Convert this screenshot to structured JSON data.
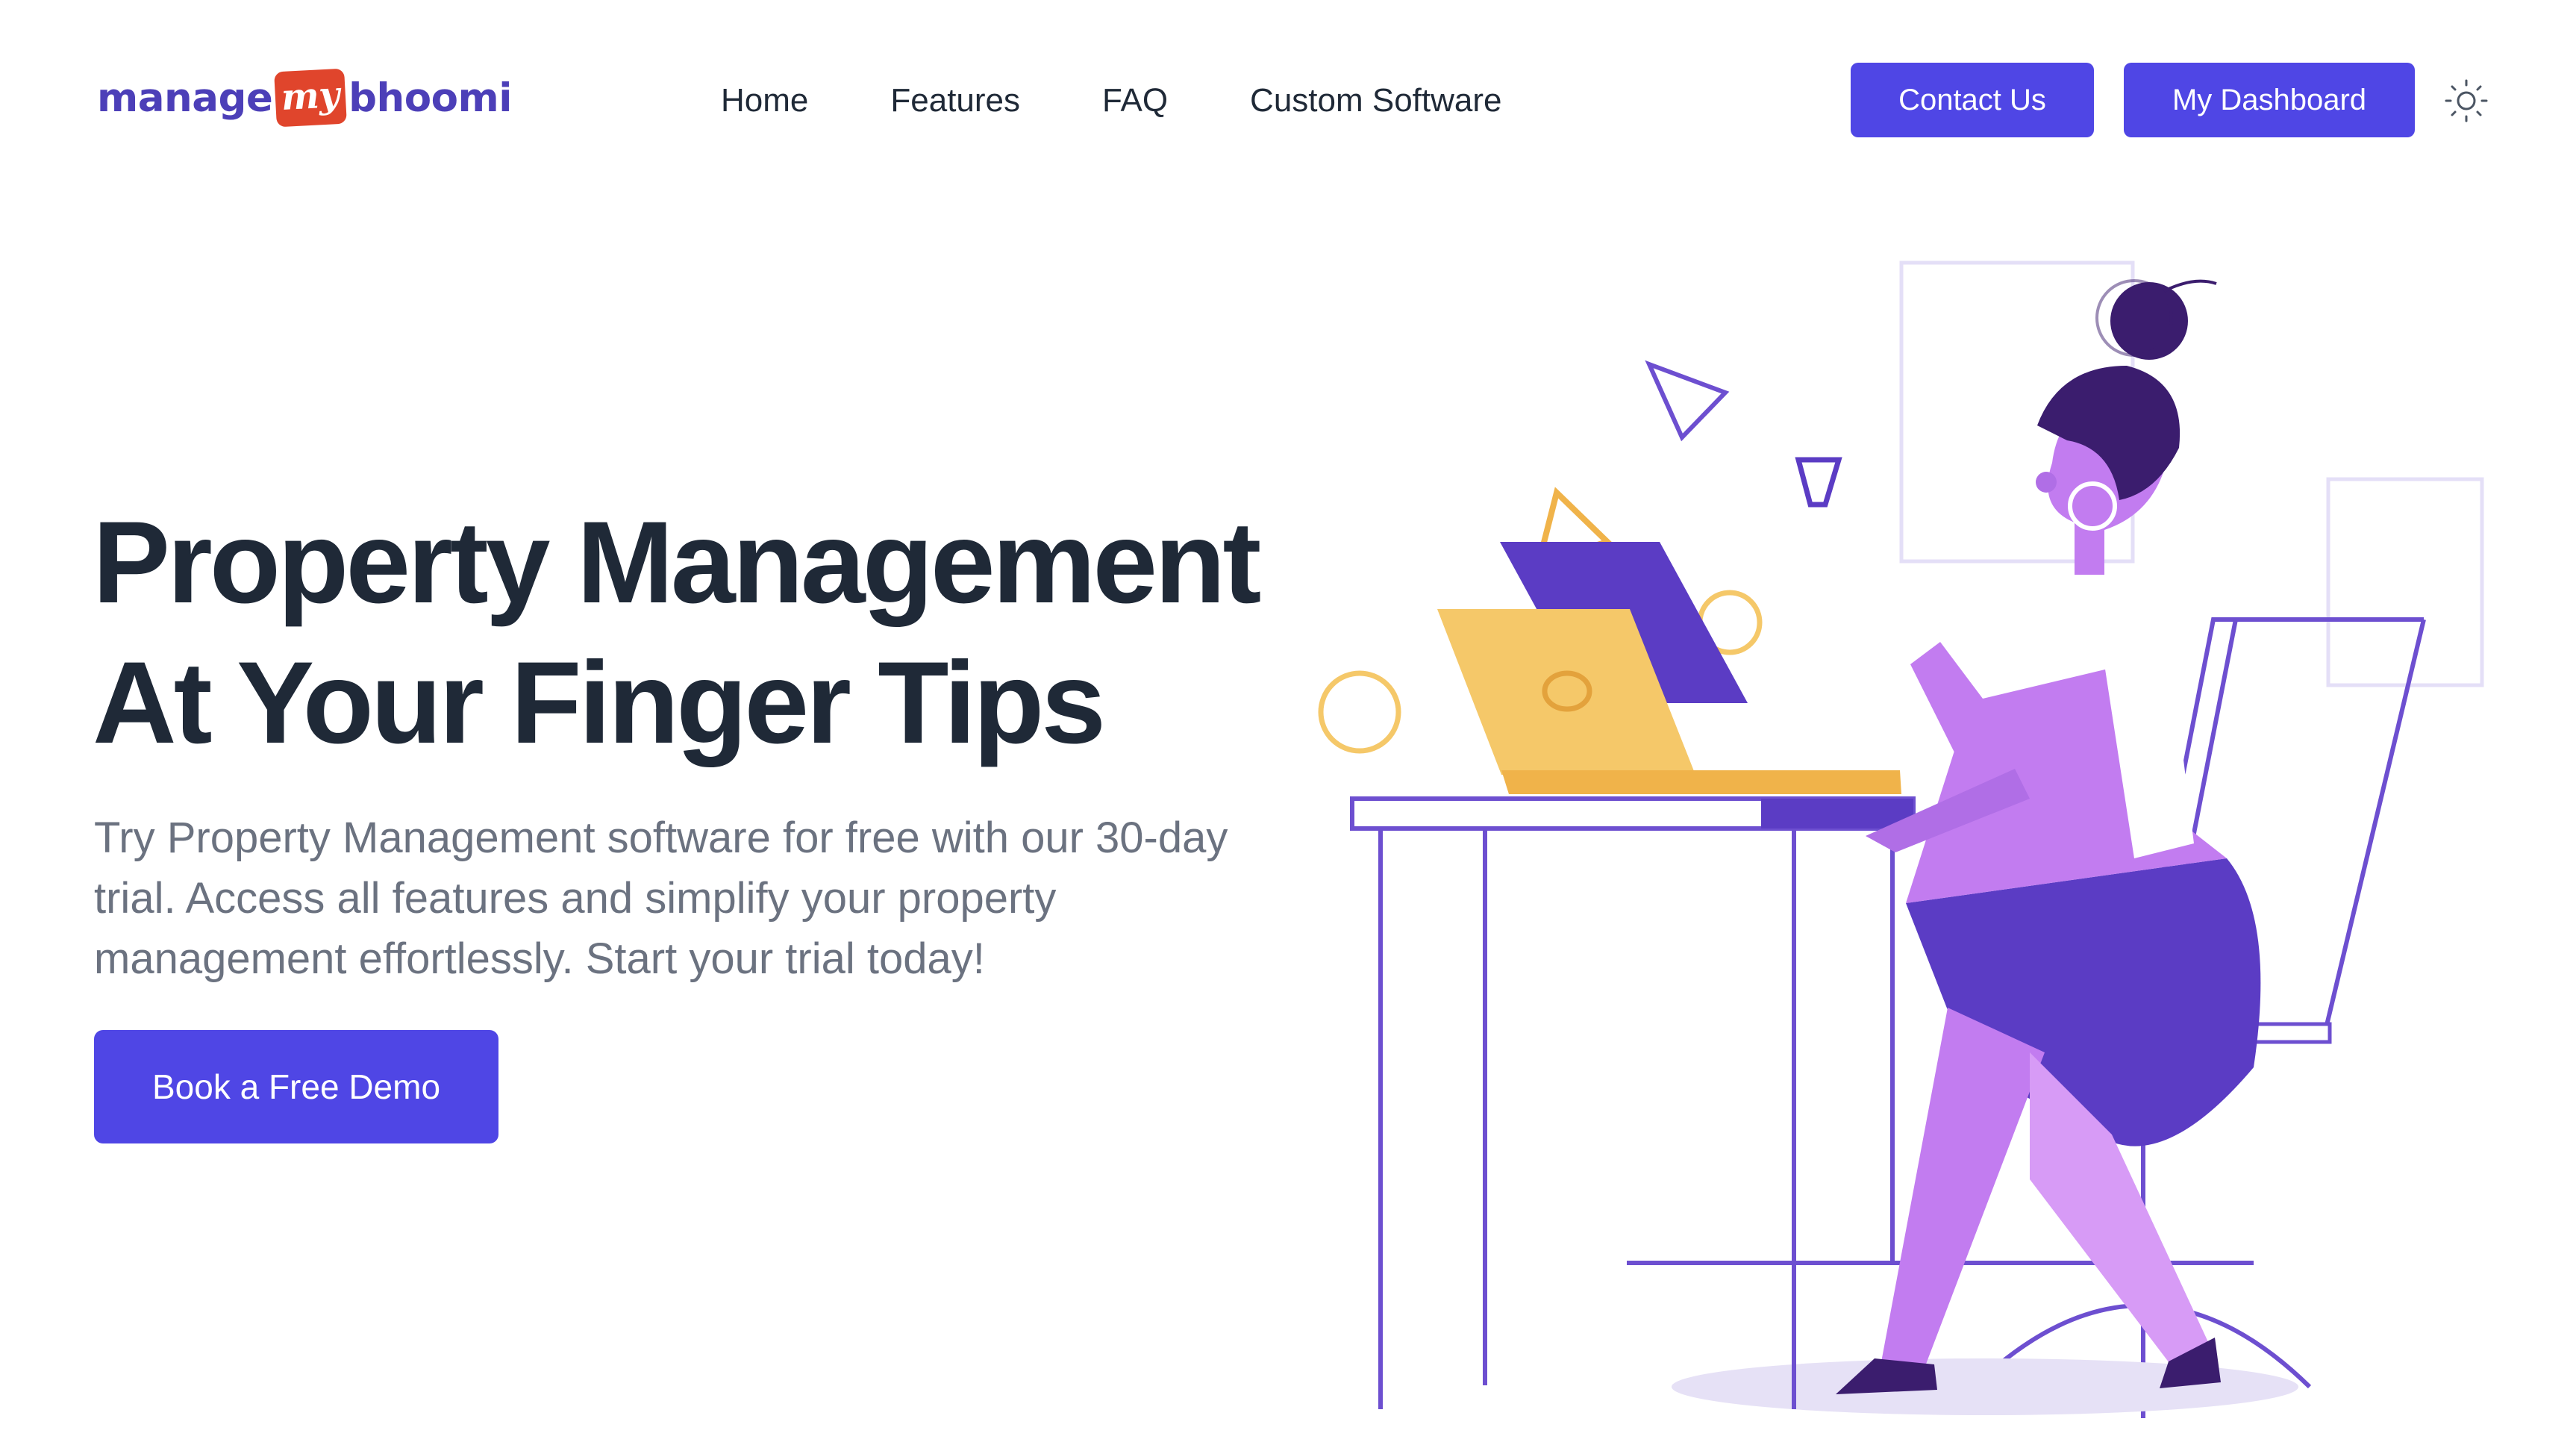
{
  "logo": {
    "part1": "manage",
    "badge": "my",
    "part2": "bhoomi"
  },
  "nav": {
    "links": [
      "Home",
      "Features",
      "FAQ",
      "Custom Software"
    ],
    "contact_label": "Contact Us",
    "dashboard_label": "My Dashboard",
    "theme_icon": "sun-icon"
  },
  "hero": {
    "title_line1": "Property Management",
    "title_line2": "At Your Finger Tips",
    "description": "Try Property Management software for free with our 30-day trial. Access all features and simplify your property management effortlessly. Start your trial today!",
    "cta_label": "Book a Free Demo"
  },
  "colors": {
    "primary": "#4f46e5",
    "heading": "#1f2937",
    "body_text": "#6b7280",
    "logo_blue": "#4c3fb8",
    "logo_badge": "#e0452c",
    "illustration_purple": "#5b3cc4",
    "illustration_lilac": "#c27cf0",
    "illustration_yellow": "#f5c869"
  },
  "illustration": {
    "icon": "woman-at-desk-with-laptop-illustration"
  }
}
